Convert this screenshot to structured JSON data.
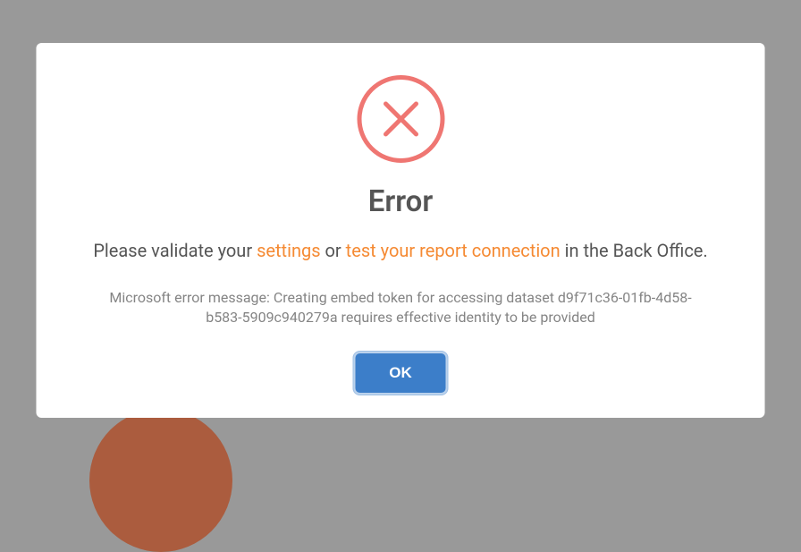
{
  "dialog": {
    "title": "Error",
    "message_prefix": "Please validate your ",
    "message_link1": "settings",
    "message_mid": " or ",
    "message_link2": "test your report connection",
    "message_suffix": " in the Back Office.",
    "submessage": "Microsoft error message: Creating embed token for accessing dataset d9f71c36-01fb-4d58-b583-5909c940279a requires effective identity to be provided",
    "ok_label": "OK"
  },
  "colors": {
    "accent_link": "#f58a33",
    "error_icon": "#ef7672",
    "button_bg": "#3c7ec9"
  }
}
